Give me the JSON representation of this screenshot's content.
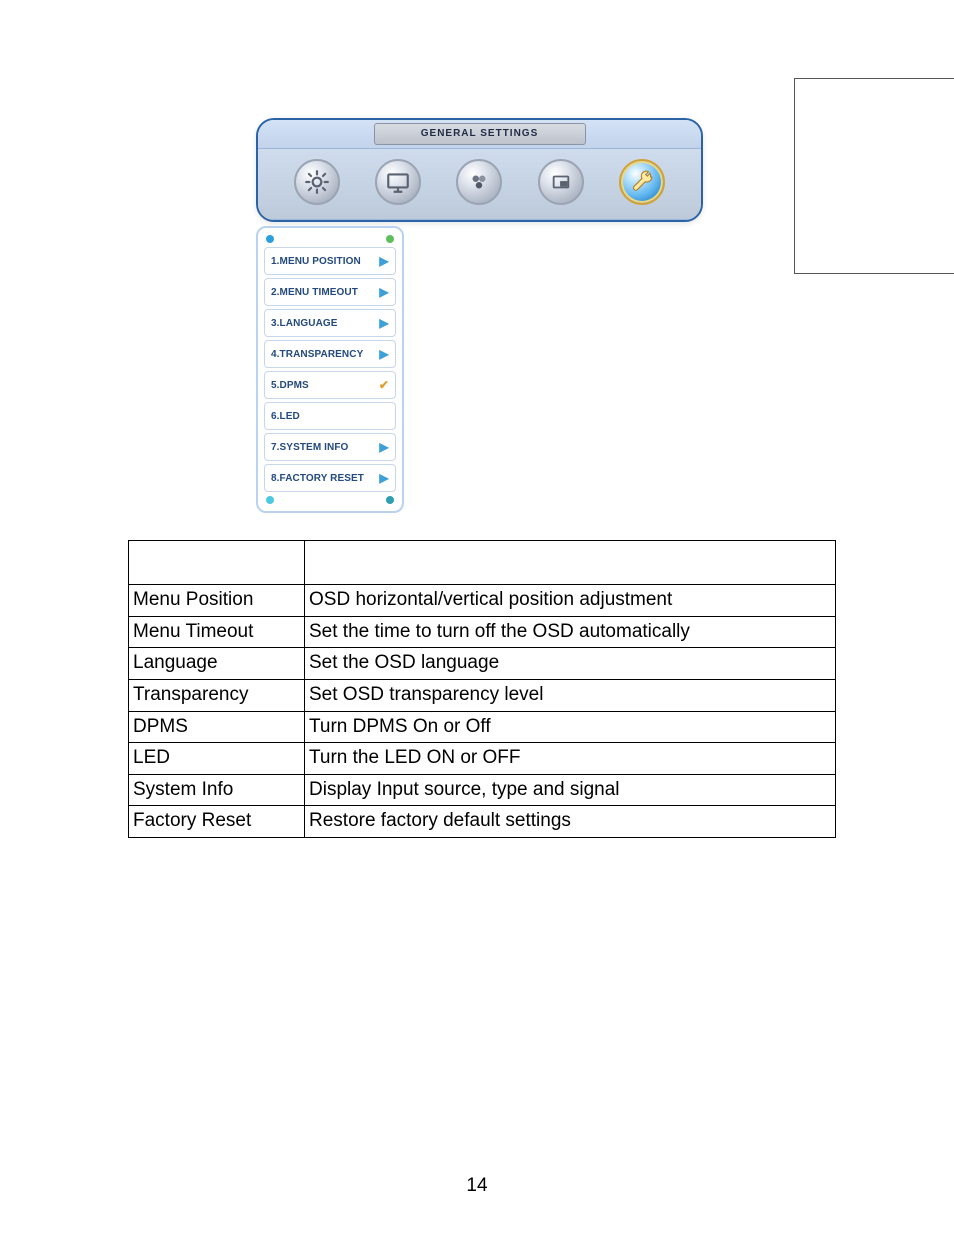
{
  "osd": {
    "title": "GENERAL SETTINGS",
    "tabs": [
      {
        "name": "brightness-icon",
        "active": false
      },
      {
        "name": "display-icon",
        "active": false
      },
      {
        "name": "color-icon",
        "active": false
      },
      {
        "name": "pip-icon",
        "active": false
      },
      {
        "name": "settings-icon",
        "active": true
      }
    ],
    "submenu": [
      {
        "label": "1.MENU POSITION",
        "indicator": "arrow"
      },
      {
        "label": "2.MENU TIMEOUT",
        "indicator": "arrow"
      },
      {
        "label": "3.LANGUAGE",
        "indicator": "arrow"
      },
      {
        "label": "4.TRANSPARENCY",
        "indicator": "arrow"
      },
      {
        "label": "5.DPMS",
        "indicator": "check"
      },
      {
        "label": "6.LED",
        "indicator": "none"
      },
      {
        "label": "7.SYSTEM INFO",
        "indicator": "arrow"
      },
      {
        "label": "8.FACTORY RESET",
        "indicator": "arrow"
      }
    ]
  },
  "table": {
    "rows": [
      {
        "name": "Menu Position",
        "desc": "OSD horizontal/vertical position adjustment"
      },
      {
        "name": "Menu Timeout",
        "desc": "Set the time to turn off the OSD automatically"
      },
      {
        "name": "Language",
        "desc": "Set the OSD language"
      },
      {
        "name": "Transparency",
        "desc": "Set OSD transparency level"
      },
      {
        "name": "DPMS",
        "desc": "Turn DPMS On or Off"
      },
      {
        "name": "LED",
        "desc": "Turn the LED ON or OFF"
      },
      {
        "name": "System Info",
        "desc": "Display Input source, type and signal"
      },
      {
        "name": "Factory Reset",
        "desc": "Restore factory default settings"
      }
    ]
  },
  "page_number": "14"
}
